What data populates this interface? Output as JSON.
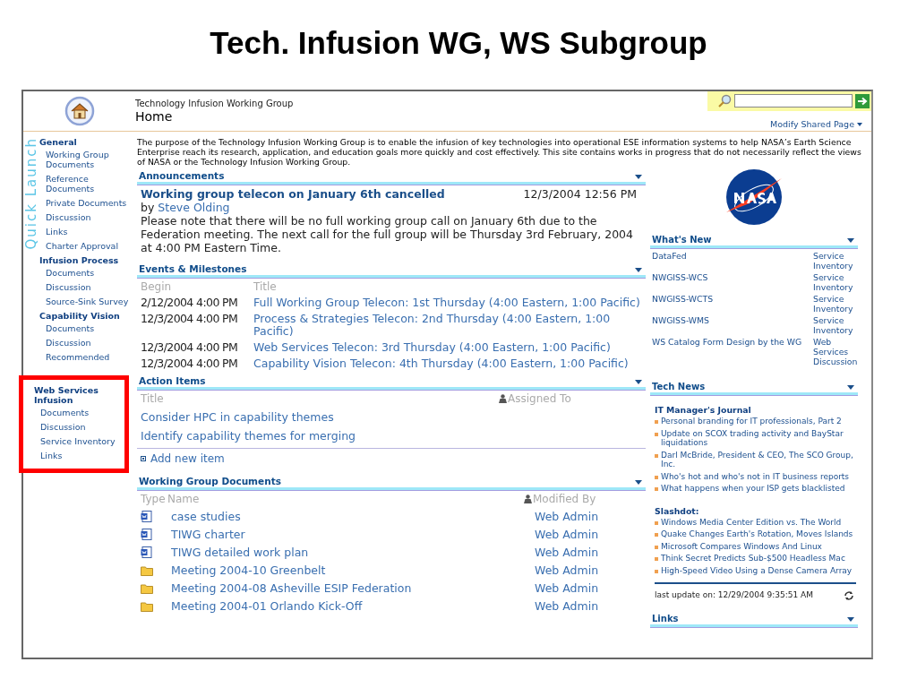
{
  "slide_title": "Tech. Infusion WG, WS Subgroup",
  "site": {
    "parent": "Technology Infusion Working Group",
    "title": "Home"
  },
  "modify_link": "Modify Shared Page",
  "quick_launch": {
    "label": "Quick Launch",
    "groups": [
      {
        "title": "General",
        "highlighted": false,
        "items": [
          "Working Group Documents",
          "Reference Documents",
          "Private Documents",
          "Discussion",
          "Links",
          "Charter Approval"
        ]
      },
      {
        "title": "Infusion Process",
        "highlighted": false,
        "items": [
          "Documents",
          "Discussion",
          "Source-Sink Survey"
        ]
      },
      {
        "title": "Capability Vision",
        "highlighted": false,
        "items": [
          "Documents",
          "Discussion",
          "Recommended"
        ]
      },
      {
        "title": "Web Services Infusion",
        "highlighted": true,
        "items": [
          "Documents",
          "Discussion",
          "Service Inventory",
          "Links"
        ]
      }
    ]
  },
  "description": "The purpose of the Technology Infusion Working Group is to enable the infusion of key technologies into operational ESE information systems to help NASA’s Earth Science Enterprise reach its research, application, and education goals more quickly and cost effectively.  This site contains works in progress that do not necessarily reflect the views of NASA or the Technology Infusion Working Group.",
  "announcements": {
    "title": "Announcements",
    "items": [
      {
        "title": "Working group telecon on January 6th cancelled",
        "date": "12/3/2004 12:56 PM",
        "by_label": "by",
        "author": "Steve Olding",
        "body": "Please note that there will be no full working group call on January 6th due to the Federation meeting. The next call for the full group will be Thursday 3rd February, 2004 at 4:00 PM Eastern Time."
      }
    ]
  },
  "events": {
    "title": "Events & Milestones",
    "columns": [
      "Begin",
      "Title"
    ],
    "rows": [
      {
        "begin": "2/12/2004 4:00 PM",
        "title": "Full Working Group Telecon: 1st Thursday (4:00 Eastern, 1:00 Pacific)"
      },
      {
        "begin": "12/3/2004 4:00 PM",
        "title": "Process & Strategies Telecon: 2nd Thursday (4:00 Eastern, 1:00 Pacific)"
      },
      {
        "begin": "12/3/2004 4:00 PM",
        "title": "Web Services Telecon: 3rd Thursday (4:00 Eastern, 1:00 Pacific)"
      },
      {
        "begin": "12/3/2004 4:00 PM",
        "title": "Capability Vision Telecon: 4th Thursday (4:00 Eastern, 1:00 Pacific)"
      }
    ]
  },
  "action_items": {
    "title": "Action Items",
    "columns": [
      "Title",
      "Assigned To"
    ],
    "rows": [
      "Consider HPC in capability themes",
      "Identify capability themes for merging"
    ],
    "add_link": "Add new item"
  },
  "documents": {
    "title": "Working Group Documents",
    "columns": [
      "Type",
      "Name",
      "Modified By"
    ],
    "rows": [
      {
        "kind": "doc",
        "name": "case studies",
        "modified_by": "Web Admin"
      },
      {
        "kind": "doc",
        "name": "TIWG charter",
        "modified_by": "Web Admin"
      },
      {
        "kind": "doc",
        "name": "TIWG detailed work plan",
        "modified_by": "Web Admin"
      },
      {
        "kind": "folder",
        "name": "Meeting 2004-10 Greenbelt",
        "modified_by": "Web Admin"
      },
      {
        "kind": "folder",
        "name": "Meeting 2004-08 Asheville ESIP Federation",
        "modified_by": "Web Admin"
      },
      {
        "kind": "folder",
        "name": "Meeting 2004-01 Orlando Kick-Off",
        "modified_by": "Web Admin"
      }
    ]
  },
  "whats_new": {
    "title": "What's New",
    "rows": [
      {
        "name": "DataFed",
        "location": "Service Inventory"
      },
      {
        "name": "NWGISS-WCS",
        "location": "Service Inventory"
      },
      {
        "name": "NWGISS-WCTS",
        "location": "Service Inventory"
      },
      {
        "name": "NWGISS-WMS",
        "location": "Service Inventory"
      },
      {
        "name": "WS Catalog Form Design by the WG",
        "location": "Web Services Discussion"
      }
    ]
  },
  "tech_news": {
    "title": "Tech News",
    "feeds": [
      {
        "title": "IT Manager's Journal",
        "items": [
          "Personal branding for IT professionals, Part 2",
          "Update on SCOX trading activity and BayStar liquidations",
          "Darl McBride, President & CEO, The SCO Group, Inc.",
          "Who's hot and who's not in IT business reports",
          "What happens when your ISP gets blacklisted"
        ]
      },
      {
        "title": "Slashdot:",
        "items": [
          "Windows Media Center Edition vs. The World",
          "Quake Changes Earth's Rotation, Moves Islands",
          "Microsoft Compares Windows And Linux",
          "Think Secret Predicts Sub-$500 Headless Mac",
          "High-Speed Video Using a Dense Camera Array"
        ]
      }
    ],
    "last_update": "last update on: 12/29/2004 9:35:51 AM"
  },
  "links": {
    "title": "Links"
  }
}
